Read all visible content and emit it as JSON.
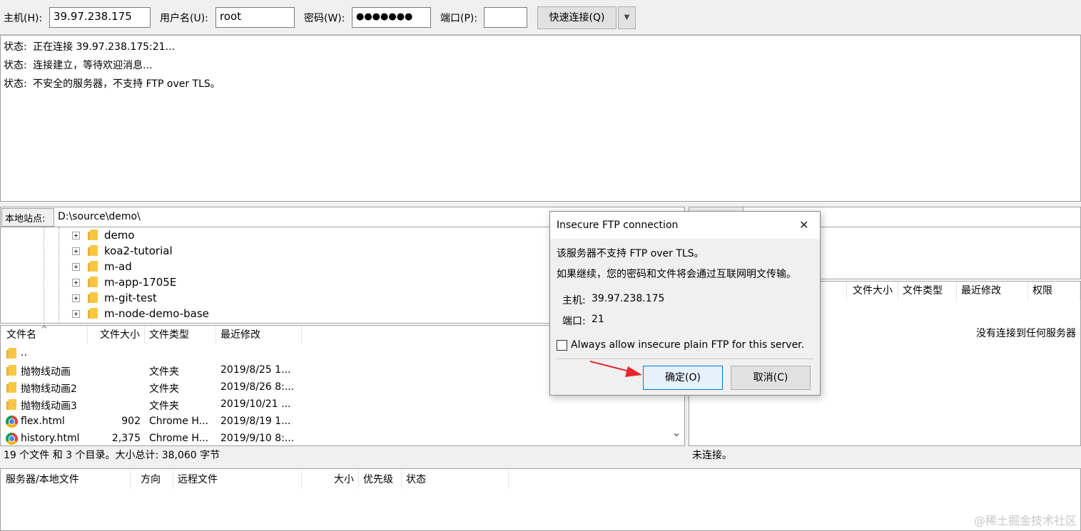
{
  "quickconnect": {
    "host_label": "主机(H):",
    "host_value": "39.97.238.175",
    "user_label": "用户名(U):",
    "user_value": "root",
    "pass_label": "密码(W):",
    "pass_value": "●●●●●●●",
    "port_label": "端口(P):",
    "port_value": "",
    "connect_label": "快速连接(Q)",
    "dropdown_glyph": "▼"
  },
  "log": [
    {
      "prefix": "状态:",
      "text": "正在连接 39.97.238.175:21..."
    },
    {
      "prefix": "状态:",
      "text": "连接建立，等待欢迎消息..."
    },
    {
      "prefix": "状态:",
      "text": "不安全的服务器，不支持 FTP over TLS。"
    }
  ],
  "local": {
    "site_label": "本地站点:",
    "path": "D:\\source\\demo\\",
    "tree": [
      "demo",
      "koa2-tutorial",
      "m-ad",
      "m-app-1705E",
      "m-git-test",
      "m-node-demo-base"
    ],
    "columns": [
      "文件名",
      "文件大小",
      "文件类型",
      "最近修改"
    ],
    "sort_glyph": "^",
    "files": [
      {
        "name": "..",
        "size": "",
        "type": "",
        "modified": "",
        "icon": "folder"
      },
      {
        "name": "抛物线动画",
        "size": "",
        "type": "文件夹",
        "modified": "2019/8/25 1...",
        "icon": "folder"
      },
      {
        "name": "抛物线动画2",
        "size": "",
        "type": "文件夹",
        "modified": "2019/8/26 8:...",
        "icon": "folder"
      },
      {
        "name": "抛物线动画3",
        "size": "",
        "type": "文件夹",
        "modified": "2019/10/21 ...",
        "icon": "folder"
      },
      {
        "name": "flex.html",
        "size": "902",
        "type": "Chrome H...",
        "modified": "2019/8/19 1...",
        "icon": "chrome"
      },
      {
        "name": "history.html",
        "size": "2,375",
        "type": "Chrome H...",
        "modified": "2019/9/10 8:...",
        "icon": "chrome"
      }
    ],
    "status": "19 个文件 和 3 个目录。大小总计: 38,060 字节",
    "scroll_down_glyph": "⌄"
  },
  "remote": {
    "columns": [
      "文件大小",
      "文件类型",
      "最近修改",
      "权限"
    ],
    "empty_message": "没有连接到任何服务器",
    "status": "未连接。"
  },
  "queue": {
    "columns": [
      "服务器/本地文件",
      "方向",
      "远程文件",
      "大小",
      "优先级",
      "状态"
    ]
  },
  "dialog": {
    "title": "Insecure FTP connection",
    "close_glyph": "✕",
    "line1": "该服务器不支持 FTP over TLS。",
    "line2": "如果继续，您的密码和文件将会通过互联网明文传输。",
    "host_label": "主机:",
    "host_value": "39.97.238.175",
    "port_label": "端口:",
    "port_value": "21",
    "checkbox_label": "Always allow insecure plain FTP for this server.",
    "ok_label": "确定(O)",
    "cancel_label": "取消(C)"
  },
  "watermark": "@稀土掘金技术社区",
  "colors": {
    "accent": "#0078d7",
    "arrow": "#e8262b",
    "ok_bg": "#e5f1fb"
  }
}
